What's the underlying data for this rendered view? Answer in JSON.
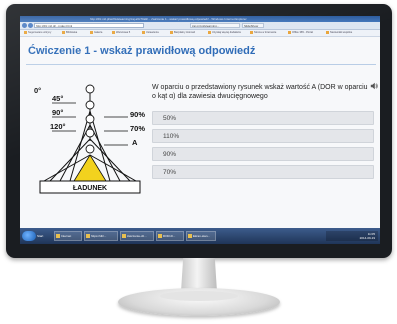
{
  "browser": {
    "window_title": "http://dlz.mil.pl/wzhk/elearning/zaj.a6c70a9/...  ćwiczenie 1 - wskaż prawidłową odpowiedź - Windows Internet Explorer",
    "url": "http://dlz.mil.pl/...index.html",
    "tabs": [
      "zaj.mil.pl/elearning...",
      "SlideShow"
    ],
    "favorites": [
      "Sugerowane witryny",
      "Biblioteka",
      "Galeria",
      "Warszawa 5",
      "Ustawienia",
      "Bezpłatny Hotmail",
      "Uzyskaj więcej dodatków",
      "Strona w Internecie",
      "Office 365 - Portal",
      "Sterowniki wspólne"
    ]
  },
  "page": {
    "title": "Ćwiczenie 1 - wskaż prawidłową odpowiedź",
    "question": "W oparciu o przedstawiony rysunek wskaż wartość A (DOR w oparciu o kąt α) dla zawiesia dwucięgnowego",
    "speaker_icon": "speaker-icon",
    "answers": [
      "50%",
      "110%",
      "90%",
      "70%"
    ]
  },
  "diagram": {
    "angles": [
      "0°",
      "45°",
      "90°",
      "120°"
    ],
    "percentages": [
      "90%",
      "70%"
    ],
    "marker": "A",
    "load_label": "ŁADUNEK",
    "fill_color": "#f2d21e"
  },
  "taskbar": {
    "start_label": "Start",
    "items": [
      "Internet",
      "https://dlz...",
      "ćwiczenie-dz...",
      "DOR-D...",
      "Ekran-stan..."
    ],
    "clock": "11:05",
    "date": "2014-09-19"
  },
  "colors": {
    "accent": "#2b69b6",
    "answer_bg": "#e4e6ea",
    "taskbar": "#1f3558"
  }
}
